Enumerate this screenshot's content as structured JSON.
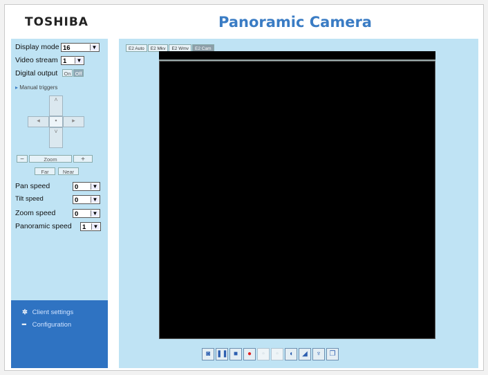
{
  "header": {
    "brand": "TOSHIBA",
    "title": "Panoramic Camera"
  },
  "sidebar": {
    "display_mode": {
      "label": "Display mode",
      "value": "16"
    },
    "video_stream": {
      "label": "Video stream",
      "value": "1"
    },
    "digital_output": {
      "label": "Digital output",
      "on": "On",
      "off": "Off"
    },
    "manual_triggers": "Manual triggers",
    "zoom_label": "Zoom",
    "focus": {
      "far": "Far",
      "near": "Near"
    },
    "pan_speed": {
      "label": "Pan speed",
      "value": "0"
    },
    "tilt_speed": {
      "label": "Tilt speed",
      "value": "0"
    },
    "zoom_speed": {
      "label": "Zoom speed",
      "value": "0"
    },
    "panoramic_speed": {
      "label": "Panoramic speed",
      "value": "1"
    },
    "links": [
      "Client settings",
      "Configuration"
    ]
  },
  "main": {
    "tabs": [
      "E2 Auto",
      "E2 Mkv",
      "E2 Wmv",
      "E2 Cam"
    ],
    "toolbar": [
      "camera-icon",
      "pause-icon",
      "stop-icon",
      "record-icon",
      "blank-icon",
      "blank-icon",
      "speaker-icon",
      "volume-icon",
      "microphone-icon",
      "fullscreen-icon"
    ]
  },
  "colors": {
    "accent": "#3a7cc4",
    "panel": "#bfe3f4",
    "sidebar_bottom": "#2f73c2",
    "video": "#000000"
  }
}
